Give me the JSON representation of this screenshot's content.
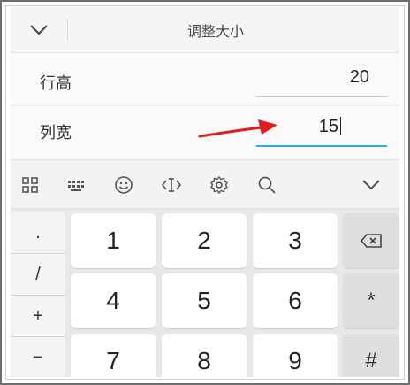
{
  "header": {
    "title": "调整大小",
    "collapse_icon": "chevron-down-icon"
  },
  "form": {
    "rows": [
      {
        "label": "行高",
        "value": "20"
      },
      {
        "label": "列宽",
        "value": "15"
      }
    ]
  },
  "toolbar": {
    "icons": [
      "grid-icon",
      "keyboard-icon",
      "emoji-icon",
      "text-cursor-icon",
      "settings-icon",
      "search-icon",
      "chevron-down-icon"
    ]
  },
  "keypad": {
    "side_keys": [
      ".",
      "/",
      "+",
      "−"
    ],
    "digits": [
      "1",
      "2",
      "3",
      "4",
      "5",
      "6",
      "7",
      "8",
      "9"
    ],
    "backspace_icon": "backspace-icon",
    "star": "*",
    "hash": "#"
  },
  "colors": {
    "accent": "#39a6df",
    "arrow": "#e21c1c"
  }
}
